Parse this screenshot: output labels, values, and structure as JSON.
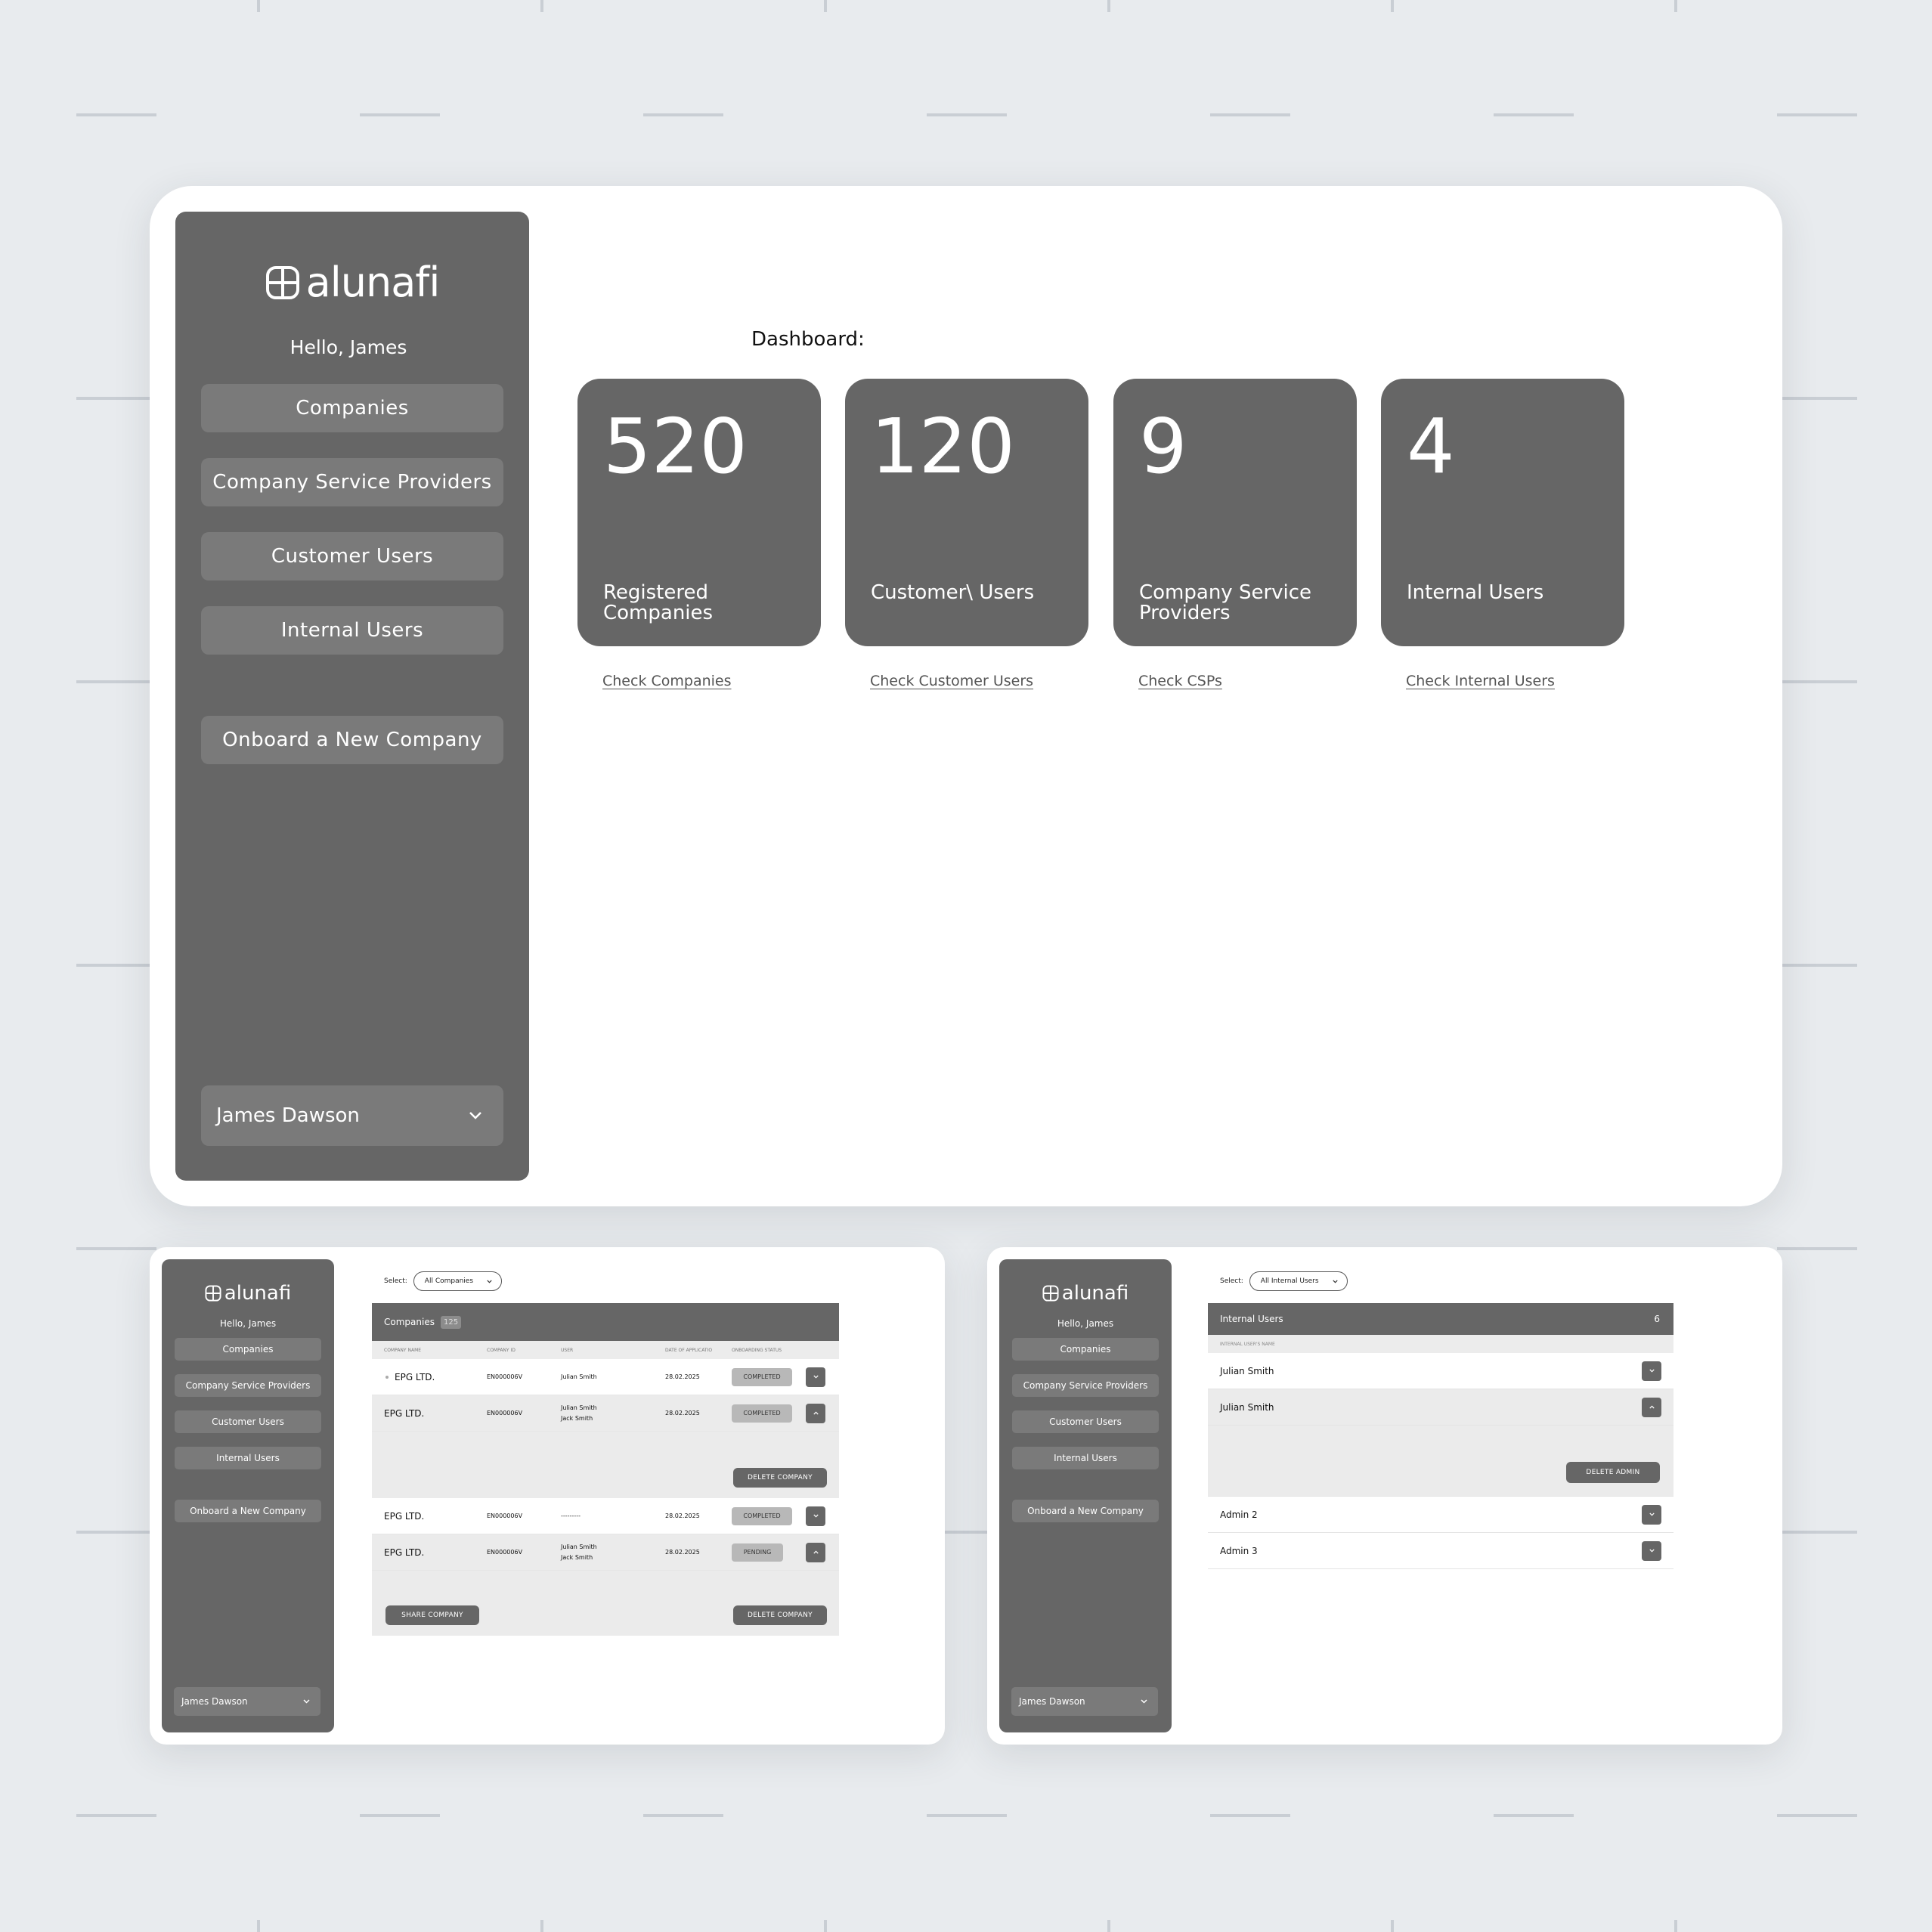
{
  "brand": {
    "name": "alunafi"
  },
  "greeting": "Hello, James",
  "nav": {
    "companies": "Companies",
    "csp": "Company Service Providers",
    "customer_users": "Customer Users",
    "internal_users": "Internal Users",
    "onboard": "Onboard a New Company"
  },
  "user": {
    "name": "James Dawson"
  },
  "dashboard": {
    "title": "Dashboard:",
    "stats": [
      {
        "value": "520",
        "label": "Registered Companies",
        "link": "Check Companies"
      },
      {
        "value": "120",
        "label": "Customer\\ Users",
        "link": "Check Customer Users"
      },
      {
        "value": "9",
        "label": "Company Service Providers",
        "link": "Check CSPs"
      },
      {
        "value": "4",
        "label": "Internal Users",
        "link": "Check Internal Users"
      }
    ]
  },
  "companies_view": {
    "select_label": "Select:",
    "select_value": "All Companies",
    "table_title": "Companies",
    "count": "125",
    "columns": [
      "COMPANY NAME",
      "COMPANY ID",
      "USER",
      "DATE OF APPLICATIO",
      "ONBOARDING STATUS"
    ],
    "rows": [
      {
        "name": "EPG LTD.",
        "id": "EN000006V",
        "user": "Julian Smith",
        "date": "28.02.2025",
        "status": "COMPLETED"
      },
      {
        "name": "EPG LTD.",
        "id": "EN000006V",
        "user": "Julian Smith\nJack Smith",
        "date": "28.02.2025",
        "status": "COMPLETED"
      },
      {
        "name": "EPG LTD.",
        "id": "EN000006V",
        "user": "---------",
        "date": "28.02.2025",
        "status": "COMPLETED"
      },
      {
        "name": "EPG LTD.",
        "id": "EN000006V",
        "user": "Julian Smith\nJack Smith",
        "date": "28.02.2025",
        "status": "PENDING"
      }
    ],
    "delete_label": "DELETE COMPANY",
    "share_label": "SHARE COMPANY"
  },
  "internal_view": {
    "select_label": "Select:",
    "select_value": "All Internal Users",
    "list_title": "Internal Users",
    "count": "6",
    "column": "INTERNAL USER'S NAME",
    "rows": [
      "Julian Smith",
      "Julian Smith",
      "Admin 2",
      "Admin 3"
    ],
    "delete_label": "DELETE ADMIN"
  },
  "colors": {
    "sidebar": "#666666",
    "nav_button": "#7a7a7a",
    "background": "#e8ebee"
  }
}
